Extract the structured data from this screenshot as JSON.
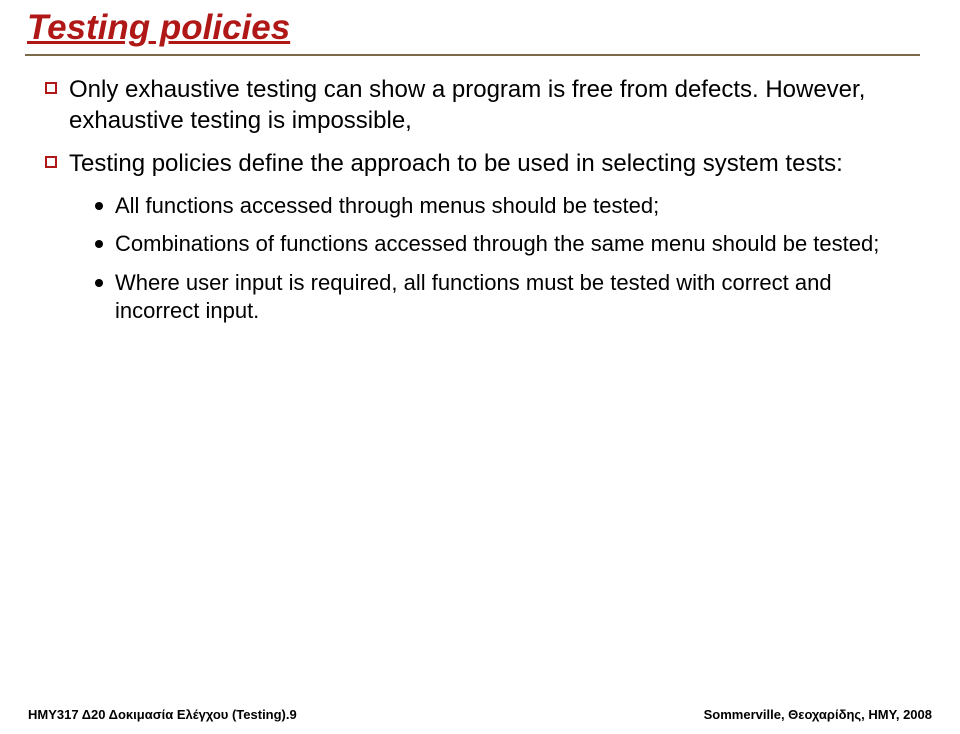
{
  "title": "Testing policies",
  "bullets": [
    {
      "text": "Only exhaustive testing can show a program is free from defects. However, exhaustive testing is impossible,"
    },
    {
      "text": "Testing policies define the approach to be used in selecting system tests:"
    }
  ],
  "subbullets": [
    {
      "text": "All functions accessed through menus should be tested;"
    },
    {
      "text": "Combinations of functions accessed through the same menu should be tested;"
    },
    {
      "text": "Where user input is required, all functions must be tested with correct and incorrect input."
    }
  ],
  "footer": {
    "left": "ΗΜΥ317 Δ20 Δοκιμασία Ελέγχου (Testing).9",
    "right": "Sommerville, Θεοχαρίδης, ΗΜΥ, 2008"
  }
}
